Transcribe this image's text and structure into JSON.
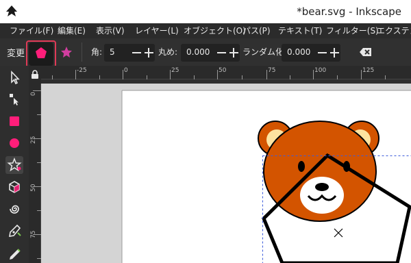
{
  "window": {
    "title": "*bear.svg - Inkscape"
  },
  "menu": [
    "ファイル(F)",
    "編集(E)",
    "表示(V)",
    "レイヤー(L)",
    "オブジェクト(O)",
    "パス(P)",
    "テキスト(T)",
    "フィルター(S)",
    "エクステンション"
  ],
  "tool_controls": {
    "mode_label": "変更",
    "corners_label": "角:",
    "corners_value": "5",
    "rounded_label": "丸め:",
    "rounded_value": "0.000",
    "randomized_label": "ランダム化:",
    "randomized_value": "0.000"
  },
  "hruler": {
    "labels": [
      "-25",
      "0",
      "25",
      "50",
      "75",
      "100",
      "125"
    ]
  },
  "vruler": {
    "labels": [
      "0",
      "25",
      "50",
      "75"
    ]
  },
  "toolbox": [
    "selector-tool",
    "node-tool",
    "rect-tool",
    "ellipse-tool",
    "star-polygon-tool",
    "3d-box-tool",
    "spiral-tool",
    "pen-tool",
    "pencil-tool"
  ],
  "colors": {
    "accent": "#e03a57",
    "polygon_icon": "#ff1e7a",
    "star_icon": "#d13ea0",
    "bear_fur": "#d35400",
    "bear_ear_inner": "#fde3a0",
    "bear_muzzle": "#ffffff"
  }
}
